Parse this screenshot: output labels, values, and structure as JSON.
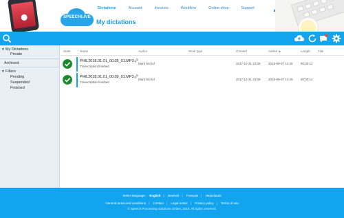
{
  "brand": {
    "logo_text": "SPEECHLIVE"
  },
  "nav": {
    "items": [
      "Dictations",
      "Account",
      "Invoices",
      "Workflow",
      "Online shop",
      "Support"
    ],
    "active": "Dictations"
  },
  "page_title": "My dictations",
  "toolbar": {
    "icons": [
      "search-icon",
      "cloud-upload-icon",
      "refresh-icon",
      "notification-icon",
      "settings-icon"
    ],
    "notification_count": ""
  },
  "sidebar": {
    "my_dictations": "My Dictations",
    "private": "Private",
    "archived": "Archived",
    "filters": "Filters",
    "pending": "Pending",
    "suspended": "Suspended",
    "finished": "Finished"
  },
  "table": {
    "headers": {
      "state": "State",
      "name": "Name",
      "author": "Author",
      "work_type": "Work type",
      "created": "Created",
      "added": "Added ▲",
      "length": "Length",
      "title": "Title"
    },
    "rows": [
      {
        "name": "PHIL2018.01.01_00.05_01.MP3",
        "status": "Transcription finished",
        "author": "Mark Nichol",
        "work_type": "",
        "created": "2017-12-31 23:05",
        "added": "2018-09-07 14:26",
        "length": "00:00:12",
        "title": ""
      },
      {
        "name": "PHIL2018.01.01_00.09_01.MP3",
        "status": "Transcription finished",
        "author": "Mark Nichol",
        "work_type": "",
        "created": "2017-12-31 23:09",
        "added": "2018-09-07 14:26",
        "length": "00:00:14",
        "title": ""
      }
    ]
  },
  "footer": {
    "select_language": "Select language:",
    "languages": [
      "English",
      "Deutsch",
      "Français",
      "Nederlands"
    ],
    "active_language": "English",
    "links": [
      "General terms and conditions",
      "Contact",
      "Legal notice",
      "Privacy policy",
      "Terms of use"
    ],
    "copyright": "© Speech Processing Solutions GmbH, 2018. All rights reserved."
  },
  "colors": {
    "accent": "#12a4ef",
    "check": "#1e8a2f",
    "sidebar_bg": "#e8f0f6",
    "title": "#1a9fe6"
  }
}
